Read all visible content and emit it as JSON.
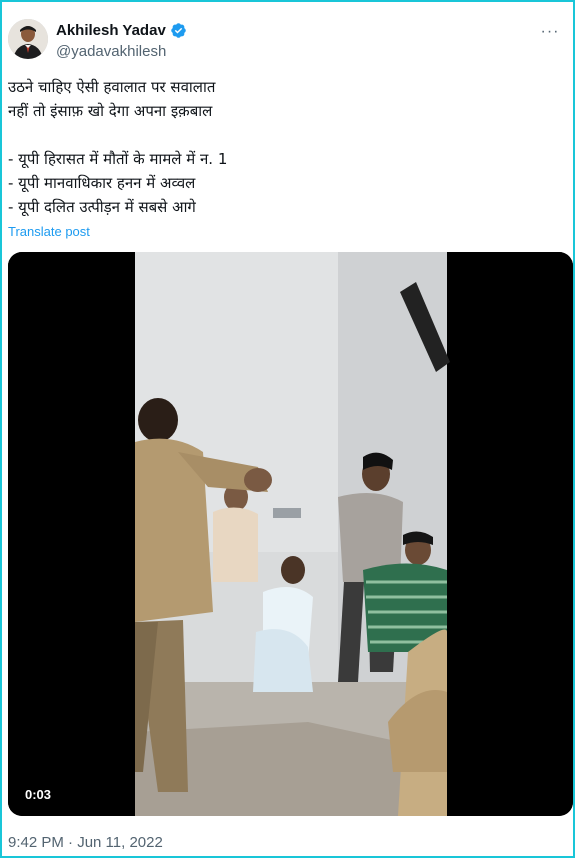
{
  "author": {
    "display_name": "Akhilesh Yadav",
    "handle": "@yadavakhilesh",
    "verified": true
  },
  "tweet": {
    "lines": [
      "उठने चाहिए ऐसी हवालात पर सवालात",
      "नहीं तो इंसाफ़ खो देगा अपना इक़बाल",
      "",
      "- यूपी हिरासत में मौतों के मामले में न. 1",
      "- यूपी मानवाधिकार हनन में अव्वल",
      "- यूपी दलित उत्पीड़न में सबसे आगे"
    ],
    "translate_label": "Translate post",
    "timestamp": "9:42 PM · Jun 11, 2022"
  },
  "video": {
    "duration": "0:03"
  },
  "icons": {
    "more": "more-options-icon",
    "verified": "verified-badge-icon"
  },
  "colors": {
    "accent": "#1d9bf0",
    "secondary_text": "#536471",
    "frame_border": "#19c6d8"
  }
}
